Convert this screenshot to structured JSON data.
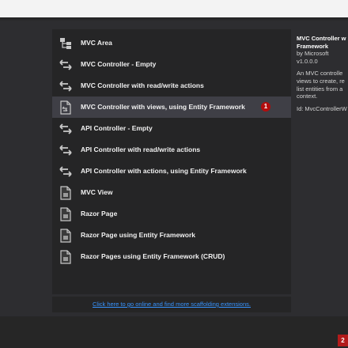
{
  "scaffold": {
    "items": [
      {
        "label": "MVC Area",
        "icon": "mvc-area-icon"
      },
      {
        "label": "MVC Controller - Empty",
        "icon": "controller-icon"
      },
      {
        "label": "MVC Controller with read/write actions",
        "icon": "controller-icon"
      },
      {
        "label": "MVC Controller with views, using Entity Framework",
        "icon": "controller-views-icon",
        "selected": true
      },
      {
        "label": "API Controller - Empty",
        "icon": "controller-icon"
      },
      {
        "label": "API Controller with read/write actions",
        "icon": "controller-icon"
      },
      {
        "label": "API Controller with actions, using Entity Framework",
        "icon": "controller-icon"
      },
      {
        "label": "MVC View",
        "icon": "view-page-icon"
      },
      {
        "label": "Razor Page",
        "icon": "view-page-icon"
      },
      {
        "label": "Razor Page using Entity Framework",
        "icon": "view-page-icon"
      },
      {
        "label": "Razor Pages using Entity Framework (CRUD)",
        "icon": "view-page-icon"
      }
    ],
    "selected_badge": "1",
    "online_link": "Click here to go online and find more scaffolding extensions."
  },
  "details": {
    "title_line1": "MVC Controller w",
    "title_line2": "Framework",
    "author": "by Microsoft",
    "version": "v1.0.0.0",
    "desc_line1": "An MVC controlle",
    "desc_line2": "views to create, re",
    "desc_line3": "list entities from a",
    "desc_line4": "context.",
    "id": "Id: MvcControllerW"
  },
  "corner_badge": "2",
  "colors": {
    "background": "#2d2d30",
    "list_background": "#252526",
    "selected_row": "#3f3f46",
    "link": "#3794ff",
    "badge": "#b20d0d"
  }
}
